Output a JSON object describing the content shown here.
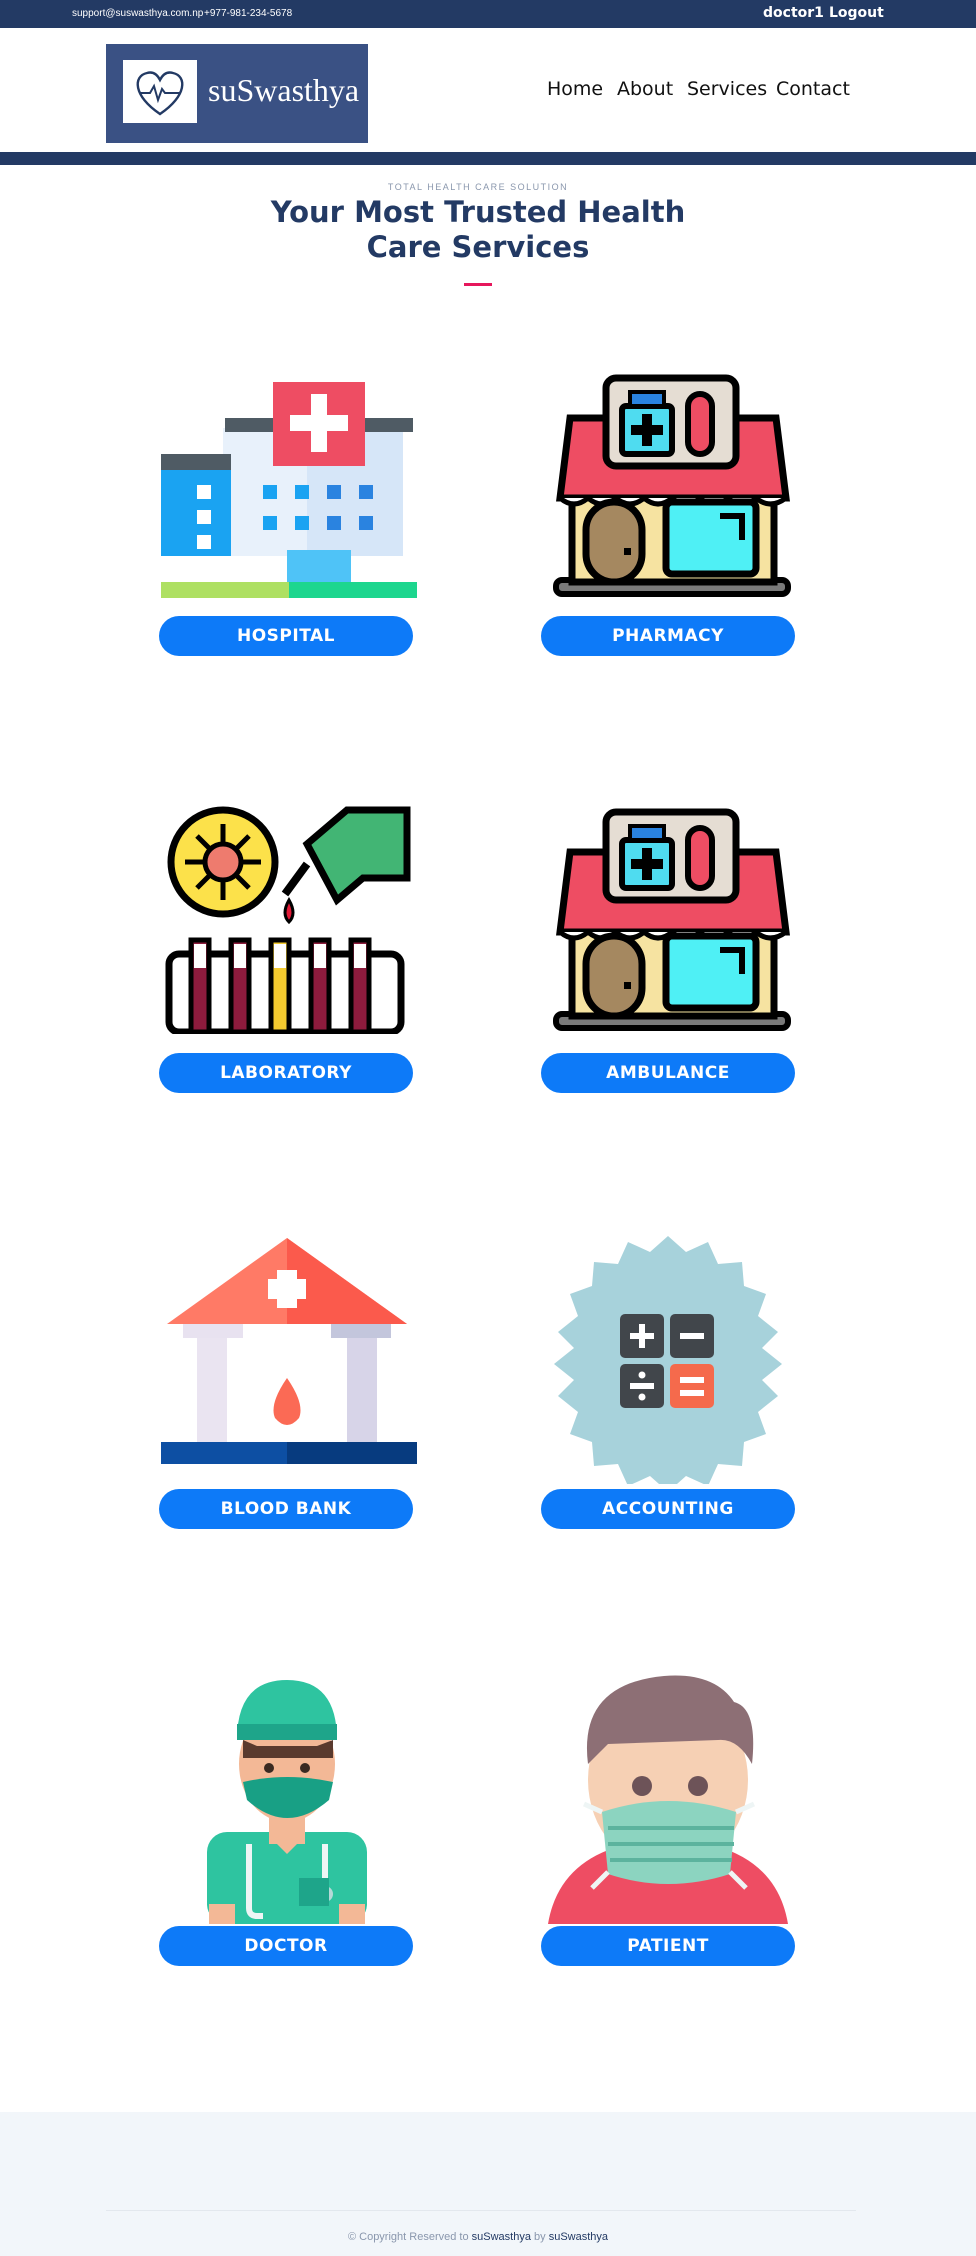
{
  "topbar": {
    "email": "support@suswasthya.com.np",
    "phone": "+977-981-234-5678",
    "user": "doctor1",
    "logout": "Logout"
  },
  "brand": {
    "name": "suSwasthya"
  },
  "nav": [
    "Home",
    "About",
    "Services",
    "Contact"
  ],
  "section": {
    "eyebrow": "TOTAL HEALTH CARE SOLUTION",
    "title_line1": "Your Most Trusted Health",
    "title_line2": "Care Services"
  },
  "services": [
    {
      "label": "HOSPITAL",
      "icon": "hospital-icon"
    },
    {
      "label": "PHARMACY",
      "icon": "pharmacy-store-icon"
    },
    {
      "label": "LABORATORY",
      "icon": "laboratory-icon"
    },
    {
      "label": "AMBULANCE",
      "icon": "pharmacy-store-icon"
    },
    {
      "label": "BLOOD BANK",
      "icon": "blood-bank-icon"
    },
    {
      "label": "ACCOUNTING",
      "icon": "calculator-badge-icon"
    },
    {
      "label": "DOCTOR",
      "icon": "doctor-avatar-icon"
    },
    {
      "label": "PATIENT",
      "icon": "patient-avatar-icon"
    }
  ],
  "footer": {
    "prefix": "© Copyright Reserved to",
    "site": "suSwasthya",
    "by": "by",
    "author": "suSwasthya"
  },
  "colors": {
    "navy": "#233a64",
    "button_blue": "#0d7af8",
    "accent_pink": "#e6175c"
  }
}
